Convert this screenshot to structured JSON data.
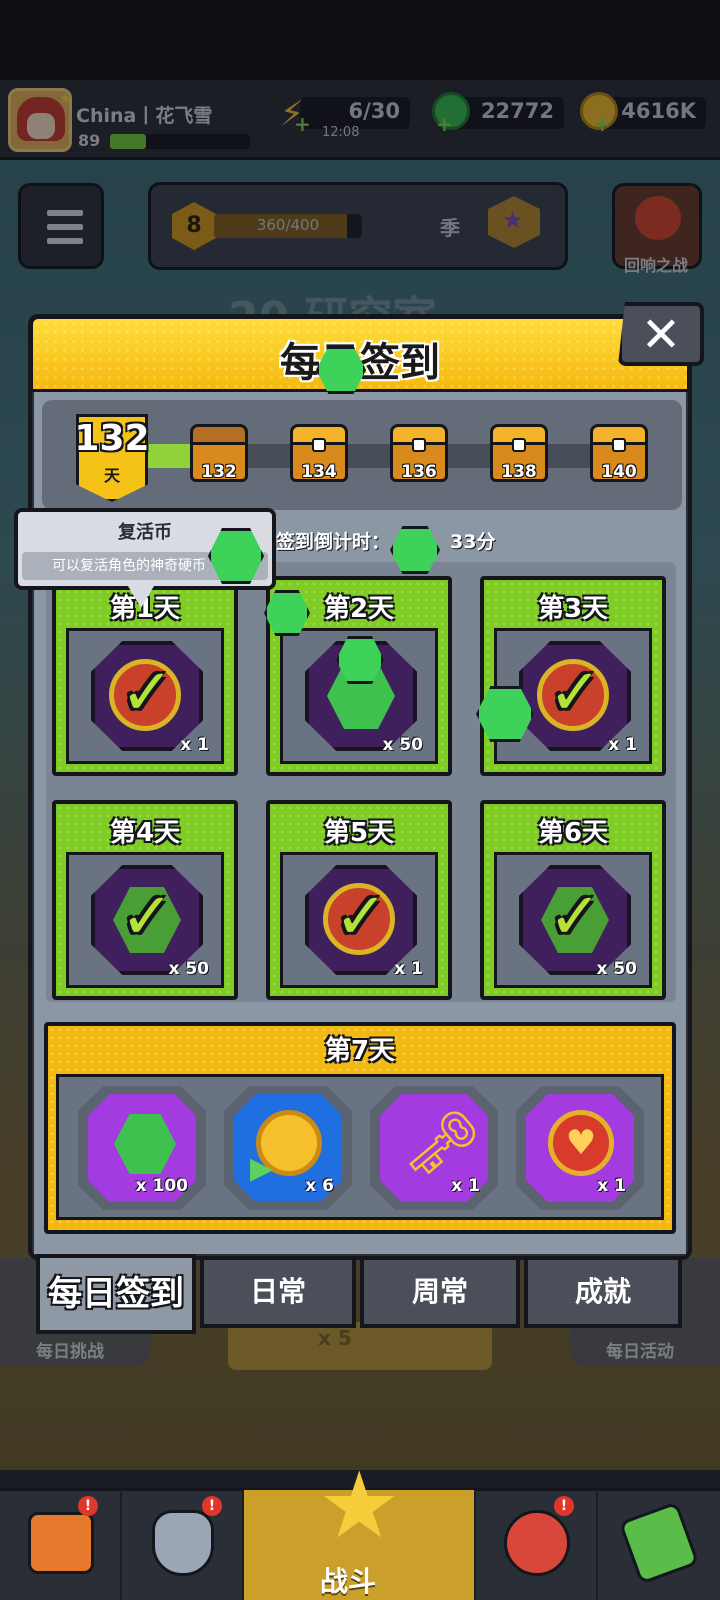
{
  "player": {
    "name": "China丨花飞雪",
    "level": "89"
  },
  "resources": {
    "energy": "6/30",
    "energy_timer": "12:08",
    "gems": "22772",
    "gold": "4616K"
  },
  "season": {
    "level": "8",
    "progress": "360/400",
    "progress_fraction": 0.9,
    "label": "季"
  },
  "boss_button": {
    "label": "回响之战"
  },
  "background_title": "20 研究室",
  "modal": {
    "title": "每日签到",
    "close_label": "✕",
    "streak": {
      "days": "132",
      "unit": "天",
      "checkpoints": [
        "132",
        "134",
        "136",
        "138",
        "140"
      ]
    },
    "countdown": "签到倒计时：",
    "countdown_value": "33分",
    "days": [
      {
        "label": "第1天",
        "item": "revive-coin",
        "qty": "x 1",
        "claimed": true
      },
      {
        "label": "第2天",
        "item": "gem",
        "qty": "x 50",
        "claimed": false
      },
      {
        "label": "第3天",
        "item": "revive-coin",
        "qty": "x 1",
        "claimed": true
      },
      {
        "label": "第4天",
        "item": "gem",
        "qty": "x 50",
        "claimed": true
      },
      {
        "label": "第5天",
        "item": "revive-coin",
        "qty": "x 1",
        "claimed": true
      },
      {
        "label": "第6天",
        "item": "gem",
        "qty": "x 50",
        "claimed": true
      }
    ],
    "day7": {
      "label": "第7天",
      "rewards": [
        {
          "item": "gem",
          "qty": "x 100"
        },
        {
          "item": "gold-coin",
          "qty": "x 6"
        },
        {
          "item": "key",
          "qty": "x 1"
        },
        {
          "item": "heart-coin",
          "qty": "x 1"
        }
      ]
    },
    "tabs": [
      "每日签到",
      "日常",
      "周常",
      "成就"
    ]
  },
  "tooltip": {
    "title": "复活币",
    "desc": "可以复活角色的神奇硬币"
  },
  "under": {
    "left_label": "每日挑战",
    "right_label": "每日活动",
    "mid_label": "x 5"
  },
  "bottom_nav": {
    "battle_label": "战斗"
  },
  "colors": {
    "header_yellow": "#f5c318",
    "card_green": "#7fcc24",
    "modal_gray": "#8c97a6",
    "gem_green": "#3fd25a"
  }
}
